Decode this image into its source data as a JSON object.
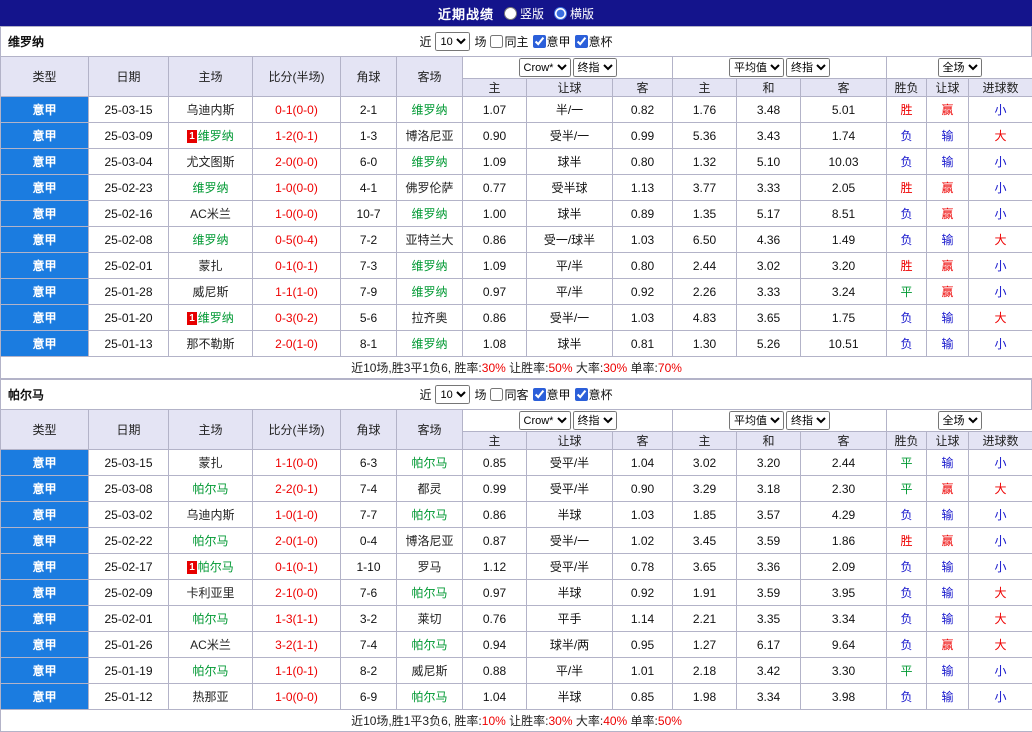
{
  "colors": {
    "topbar_bg": "#14148C",
    "header_bg": "#E4E4F4",
    "league_cell_bg": "#1B7CE0",
    "red": "#EE0000",
    "blue": "#1515CC",
    "green": "#009933",
    "badge_bg": "#E60000",
    "result_map": {
      "胜": "red",
      "平": "green",
      "负": "blue",
      "赢": "red",
      "输": "blue",
      "大": "red",
      "小": "blue"
    }
  },
  "topbar": {
    "title": "近期战绩",
    "options": [
      {
        "label": "竖版",
        "selected": false
      },
      {
        "label": "横版",
        "selected": true
      }
    ]
  },
  "columns": {
    "type": "类型",
    "date": "日期",
    "home": "主场",
    "score": "比分(半场)",
    "corner": "角球",
    "away": "客场",
    "bookmaker": "Crow*",
    "final1": "终指",
    "average": "平均值",
    "final2": "终指",
    "fullgame": "全场",
    "sub": [
      "主",
      "让球",
      "客",
      "主",
      "和",
      "客",
      "胜负",
      "让球",
      "进球数"
    ]
  },
  "sections": [
    {
      "team": "维罗纳",
      "controls": {
        "prefix": "近",
        "count": "10",
        "suffix": "场",
        "checkboxes": [
          {
            "label": "同主",
            "checked": false
          },
          {
            "label": "意甲",
            "checked": true
          },
          {
            "label": "意杯",
            "checked": true
          }
        ]
      },
      "rows": [
        {
          "league": "意甲",
          "date": "25-03-15",
          "home": "乌迪内斯",
          "home_badge": "",
          "home_focus": false,
          "score": "0-1(0-0)",
          "corner": "2-1",
          "away": "维罗纳",
          "away_badge": "",
          "away_focus": true,
          "o1": "1.07",
          "handicap": "半/一",
          "o2": "0.82",
          "e1": "1.76",
          "e2": "3.48",
          "e3": "5.01",
          "res": "胜",
          "hres": "赢",
          "goals": "小"
        },
        {
          "league": "意甲",
          "date": "25-03-09",
          "home": "维罗纳",
          "home_badge": "1",
          "home_focus": true,
          "score": "1-2(0-1)",
          "corner": "1-3",
          "away": "博洛尼亚",
          "away_badge": "",
          "away_focus": false,
          "o1": "0.90",
          "handicap": "受半/一",
          "o2": "0.99",
          "e1": "5.36",
          "e2": "3.43",
          "e3": "1.74",
          "res": "负",
          "hres": "输",
          "goals": "大"
        },
        {
          "league": "意甲",
          "date": "25-03-04",
          "home": "尤文图斯",
          "home_badge": "",
          "home_focus": false,
          "score": "2-0(0-0)",
          "corner": "6-0",
          "away": "维罗纳",
          "away_badge": "",
          "away_focus": true,
          "o1": "1.09",
          "handicap": "球半",
          "o2": "0.80",
          "e1": "1.32",
          "e2": "5.10",
          "e3": "10.03",
          "res": "负",
          "hres": "输",
          "goals": "小"
        },
        {
          "league": "意甲",
          "date": "25-02-23",
          "home": "维罗纳",
          "home_badge": "",
          "home_focus": true,
          "score": "1-0(0-0)",
          "corner": "4-1",
          "away": "佛罗伦萨",
          "away_badge": "",
          "away_focus": false,
          "o1": "0.77",
          "handicap": "受半球",
          "o2": "1.13",
          "e1": "3.77",
          "e2": "3.33",
          "e3": "2.05",
          "res": "胜",
          "hres": "赢",
          "goals": "小"
        },
        {
          "league": "意甲",
          "date": "25-02-16",
          "home": "AC米兰",
          "home_badge": "",
          "home_focus": false,
          "score": "1-0(0-0)",
          "corner": "10-7",
          "away": "维罗纳",
          "away_badge": "",
          "away_focus": true,
          "o1": "1.00",
          "handicap": "球半",
          "o2": "0.89",
          "e1": "1.35",
          "e2": "5.17",
          "e3": "8.51",
          "res": "负",
          "hres": "赢",
          "goals": "小"
        },
        {
          "league": "意甲",
          "date": "25-02-08",
          "home": "维罗纳",
          "home_badge": "",
          "home_focus": true,
          "score": "0-5(0-4)",
          "corner": "7-2",
          "away": "亚特兰大",
          "away_badge": "",
          "away_focus": false,
          "o1": "0.86",
          "handicap": "受一/球半",
          "o2": "1.03",
          "e1": "6.50",
          "e2": "4.36",
          "e3": "1.49",
          "res": "负",
          "hres": "输",
          "goals": "大"
        },
        {
          "league": "意甲",
          "date": "25-02-01",
          "home": "蒙扎",
          "home_badge": "",
          "home_focus": false,
          "score": "0-1(0-1)",
          "corner": "7-3",
          "away": "维罗纳",
          "away_badge": "",
          "away_focus": true,
          "o1": "1.09",
          "handicap": "平/半",
          "o2": "0.80",
          "e1": "2.44",
          "e2": "3.02",
          "e3": "3.20",
          "res": "胜",
          "hres": "赢",
          "goals": "小"
        },
        {
          "league": "意甲",
          "date": "25-01-28",
          "home": "威尼斯",
          "home_badge": "",
          "home_focus": false,
          "score": "1-1(1-0)",
          "corner": "7-9",
          "away": "维罗纳",
          "away_badge": "",
          "away_focus": true,
          "o1": "0.97",
          "handicap": "平/半",
          "o2": "0.92",
          "e1": "2.26",
          "e2": "3.33",
          "e3": "3.24",
          "res": "平",
          "hres": "赢",
          "goals": "小"
        },
        {
          "league": "意甲",
          "date": "25-01-20",
          "home": "维罗纳",
          "home_badge": "1",
          "home_focus": true,
          "score": "0-3(0-2)",
          "corner": "5-6",
          "away": "拉齐奥",
          "away_badge": "",
          "away_focus": false,
          "o1": "0.86",
          "handicap": "受半/一",
          "o2": "1.03",
          "e1": "4.83",
          "e2": "3.65",
          "e3": "1.75",
          "res": "负",
          "hres": "输",
          "goals": "大"
        },
        {
          "league": "意甲",
          "date": "25-01-13",
          "home": "那不勒斯",
          "home_badge": "",
          "home_focus": false,
          "score": "2-0(1-0)",
          "corner": "8-1",
          "away": "维罗纳",
          "away_badge": "",
          "away_focus": true,
          "o1": "1.08",
          "handicap": "球半",
          "o2": "0.81",
          "e1": "1.30",
          "e2": "5.26",
          "e3": "10.51",
          "res": "负",
          "hres": "输",
          "goals": "小"
        }
      ],
      "summary": [
        {
          "t": "近10场,胜3平1负6, 胜率:"
        },
        {
          "t": "30%",
          "c": "red"
        },
        {
          "t": " 让胜率:"
        },
        {
          "t": "50%",
          "c": "red"
        },
        {
          "t": " 大率:"
        },
        {
          "t": "30%",
          "c": "red"
        },
        {
          "t": " 单率:"
        },
        {
          "t": "70%",
          "c": "red"
        }
      ]
    },
    {
      "team": "帕尔马",
      "controls": {
        "prefix": "近",
        "count": "10",
        "suffix": "场",
        "checkboxes": [
          {
            "label": "同客",
            "checked": false
          },
          {
            "label": "意甲",
            "checked": true
          },
          {
            "label": "意杯",
            "checked": true
          }
        ]
      },
      "rows": [
        {
          "league": "意甲",
          "date": "25-03-15",
          "home": "蒙扎",
          "home_badge": "",
          "home_focus": false,
          "score": "1-1(0-0)",
          "corner": "6-3",
          "away": "帕尔马",
          "away_badge": "",
          "away_focus": true,
          "o1": "0.85",
          "handicap": "受平/半",
          "o2": "1.04",
          "e1": "3.02",
          "e2": "3.20",
          "e3": "2.44",
          "res": "平",
          "hres": "输",
          "goals": "小"
        },
        {
          "league": "意甲",
          "date": "25-03-08",
          "home": "帕尔马",
          "home_badge": "",
          "home_focus": true,
          "score": "2-2(0-1)",
          "corner": "7-4",
          "away": "都灵",
          "away_badge": "",
          "away_focus": false,
          "o1": "0.99",
          "handicap": "受平/半",
          "o2": "0.90",
          "e1": "3.29",
          "e2": "3.18",
          "e3": "2.30",
          "res": "平",
          "hres": "赢",
          "goals": "大"
        },
        {
          "league": "意甲",
          "date": "25-03-02",
          "home": "乌迪内斯",
          "home_badge": "",
          "home_focus": false,
          "score": "1-0(1-0)",
          "corner": "7-7",
          "away": "帕尔马",
          "away_badge": "",
          "away_focus": true,
          "o1": "0.86",
          "handicap": "半球",
          "o2": "1.03",
          "e1": "1.85",
          "e2": "3.57",
          "e3": "4.29",
          "res": "负",
          "hres": "输",
          "goals": "小"
        },
        {
          "league": "意甲",
          "date": "25-02-22",
          "home": "帕尔马",
          "home_badge": "",
          "home_focus": true,
          "score": "2-0(1-0)",
          "corner": "0-4",
          "away": "博洛尼亚",
          "away_badge": "",
          "away_focus": false,
          "o1": "0.87",
          "handicap": "受半/一",
          "o2": "1.02",
          "e1": "3.45",
          "e2": "3.59",
          "e3": "1.86",
          "res": "胜",
          "hres": "赢",
          "goals": "小"
        },
        {
          "league": "意甲",
          "date": "25-02-17",
          "home": "帕尔马",
          "home_badge": "1",
          "home_focus": true,
          "score": "0-1(0-1)",
          "corner": "1-10",
          "away": "罗马",
          "away_badge": "",
          "away_focus": false,
          "o1": "1.12",
          "handicap": "受平/半",
          "o2": "0.78",
          "e1": "3.65",
          "e2": "3.36",
          "e3": "2.09",
          "res": "负",
          "hres": "输",
          "goals": "小"
        },
        {
          "league": "意甲",
          "date": "25-02-09",
          "home": "卡利亚里",
          "home_badge": "",
          "home_focus": false,
          "score": "2-1(0-0)",
          "corner": "7-6",
          "away": "帕尔马",
          "away_badge": "",
          "away_focus": true,
          "o1": "0.97",
          "handicap": "半球",
          "o2": "0.92",
          "e1": "1.91",
          "e2": "3.59",
          "e3": "3.95",
          "res": "负",
          "hres": "输",
          "goals": "大"
        },
        {
          "league": "意甲",
          "date": "25-02-01",
          "home": "帕尔马",
          "home_badge": "",
          "home_focus": true,
          "score": "1-3(1-1)",
          "corner": "3-2",
          "away": "莱切",
          "away_badge": "",
          "away_focus": false,
          "o1": "0.76",
          "handicap": "平手",
          "o2": "1.14",
          "e1": "2.21",
          "e2": "3.35",
          "e3": "3.34",
          "res": "负",
          "hres": "输",
          "goals": "大"
        },
        {
          "league": "意甲",
          "date": "25-01-26",
          "home": "AC米兰",
          "home_badge": "",
          "home_focus": false,
          "score": "3-2(1-1)",
          "corner": "7-4",
          "away": "帕尔马",
          "away_badge": "",
          "away_focus": true,
          "o1": "0.94",
          "handicap": "球半/两",
          "o2": "0.95",
          "e1": "1.27",
          "e2": "6.17",
          "e3": "9.64",
          "res": "负",
          "hres": "赢",
          "goals": "大"
        },
        {
          "league": "意甲",
          "date": "25-01-19",
          "home": "帕尔马",
          "home_badge": "",
          "home_focus": true,
          "score": "1-1(0-1)",
          "corner": "8-2",
          "away": "威尼斯",
          "away_badge": "",
          "away_focus": false,
          "o1": "0.88",
          "handicap": "平/半",
          "o2": "1.01",
          "e1": "2.18",
          "e2": "3.42",
          "e3": "3.30",
          "res": "平",
          "hres": "输",
          "goals": "小"
        },
        {
          "league": "意甲",
          "date": "25-01-12",
          "home": "热那亚",
          "home_badge": "",
          "home_focus": false,
          "score": "1-0(0-0)",
          "corner": "6-9",
          "away": "帕尔马",
          "away_badge": "",
          "away_focus": true,
          "o1": "1.04",
          "handicap": "半球",
          "o2": "0.85",
          "e1": "1.98",
          "e2": "3.34",
          "e3": "3.98",
          "res": "负",
          "hres": "输",
          "goals": "小"
        }
      ],
      "summary": [
        {
          "t": "近10场,胜1平3负6, 胜率:"
        },
        {
          "t": "10%",
          "c": "red"
        },
        {
          "t": " 让胜率:"
        },
        {
          "t": "30%",
          "c": "red"
        },
        {
          "t": " 大率:"
        },
        {
          "t": "40%",
          "c": "red"
        },
        {
          "t": " 单率:"
        },
        {
          "t": "50%",
          "c": "red"
        }
      ]
    }
  ]
}
